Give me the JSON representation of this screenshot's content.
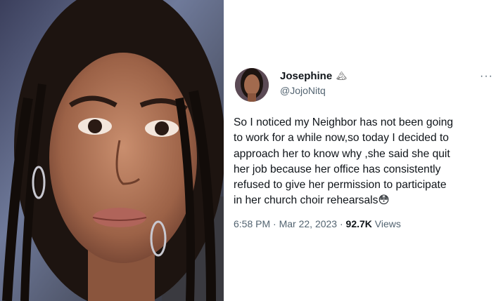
{
  "tweet": {
    "display_name": "Josephine",
    "badge_icon": "mountain-emoji",
    "handle": "@JojoNitq",
    "more_label": "···",
    "text_lines": [
      "So I noticed my Neighbor has not been going",
      "to work for a while now,so today I decided to",
      "approach her to know why ,she said she quit",
      "her job because her office has consistently",
      "refused to give her permission to participate",
      "in her church choir rehearsals😳"
    ],
    "time": "6:58 PM",
    "separator": "·",
    "date": "Mar 22, 2023",
    "views_count": "92.7K",
    "views_label": "Views"
  },
  "colors": {
    "text_primary": "#0f1419",
    "text_secondary": "#536471"
  }
}
